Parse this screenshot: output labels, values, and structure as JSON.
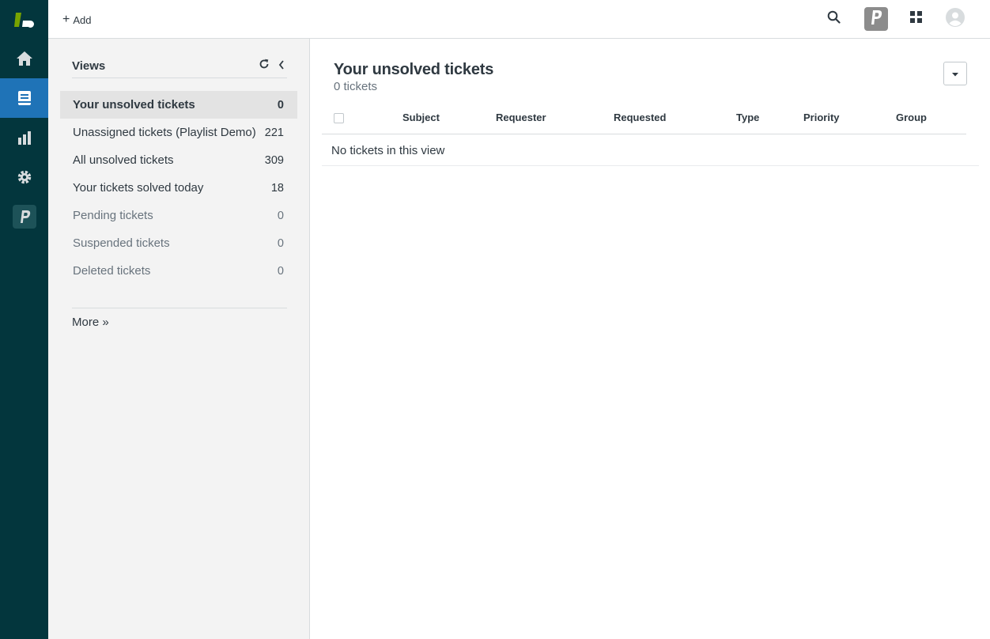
{
  "nav": {
    "logo_icon": "zendesk-logo",
    "items": [
      {
        "name": "home",
        "icon": "home-icon",
        "active": false
      },
      {
        "name": "views",
        "icon": "views-icon",
        "active": true
      },
      {
        "name": "reporting",
        "icon": "bar-chart-icon",
        "active": false
      },
      {
        "name": "admin",
        "icon": "gear-icon",
        "active": false
      },
      {
        "name": "playlist",
        "icon": "playlist-p-icon",
        "active": false
      }
    ]
  },
  "topbar": {
    "add_label": "Add",
    "icons": [
      "search-icon",
      "playlist-p-icon",
      "apps-grid-icon",
      "user-avatar-icon"
    ]
  },
  "views_panel": {
    "title": "Views",
    "items": [
      {
        "label": "Your unsolved tickets",
        "count": "0"
      },
      {
        "label": "Unassigned tickets (Playlist Demo)",
        "count": "221"
      },
      {
        "label": "All unsolved tickets",
        "count": "309"
      },
      {
        "label": "Your tickets solved today",
        "count": "18"
      },
      {
        "label": "Pending tickets",
        "count": "0"
      },
      {
        "label": "Suspended tickets",
        "count": "0"
      },
      {
        "label": "Deleted tickets",
        "count": "0"
      }
    ],
    "more_label": "More »"
  },
  "main": {
    "title": "Your unsolved tickets",
    "count_text": "0 tickets",
    "columns": [
      "Subject",
      "Requester",
      "Requested",
      "Type",
      "Priority",
      "Group"
    ],
    "empty_text": "No tickets in this view"
  },
  "colors": {
    "rail_bg": "#03363d",
    "active_nav": "#1f73b7",
    "panel_bg": "#f3f3f3",
    "logo_green": "#78a300"
  }
}
